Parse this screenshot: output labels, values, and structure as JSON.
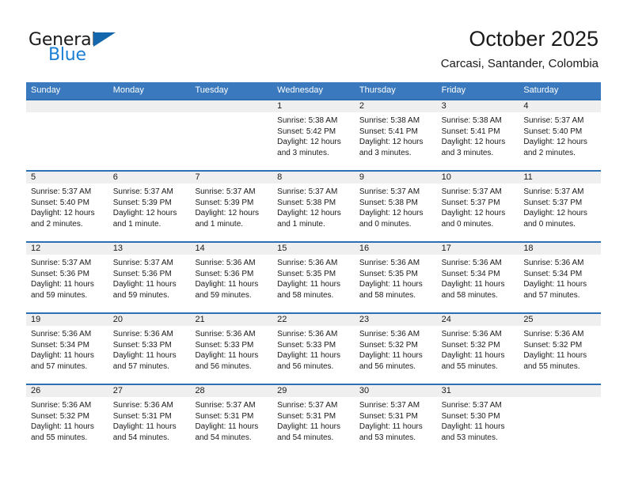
{
  "logo": {
    "text_top": "General",
    "text_bottom": "Blue",
    "accent_color": "#1c7fd4",
    "triangle_color": "#1466ad"
  },
  "header": {
    "title": "October 2025",
    "subtitle": "Carcasi, Santander, Colombia"
  },
  "theme": {
    "header_blue": "#3a79bd",
    "row_rule_blue": "#2f6fb5",
    "daynum_gray": "#efefef"
  },
  "weekdays": [
    "Sunday",
    "Monday",
    "Tuesday",
    "Wednesday",
    "Thursday",
    "Friday",
    "Saturday"
  ],
  "weeks": [
    [
      {
        "day": "",
        "sunrise": "",
        "sunset": "",
        "daylight1": "",
        "daylight2": ""
      },
      {
        "day": "",
        "sunrise": "",
        "sunset": "",
        "daylight1": "",
        "daylight2": ""
      },
      {
        "day": "",
        "sunrise": "",
        "sunset": "",
        "daylight1": "",
        "daylight2": ""
      },
      {
        "day": "1",
        "sunrise": "Sunrise: 5:38 AM",
        "sunset": "Sunset: 5:42 PM",
        "daylight1": "Daylight: 12 hours",
        "daylight2": "and 3 minutes."
      },
      {
        "day": "2",
        "sunrise": "Sunrise: 5:38 AM",
        "sunset": "Sunset: 5:41 PM",
        "daylight1": "Daylight: 12 hours",
        "daylight2": "and 3 minutes."
      },
      {
        "day": "3",
        "sunrise": "Sunrise: 5:38 AM",
        "sunset": "Sunset: 5:41 PM",
        "daylight1": "Daylight: 12 hours",
        "daylight2": "and 3 minutes."
      },
      {
        "day": "4",
        "sunrise": "Sunrise: 5:37 AM",
        "sunset": "Sunset: 5:40 PM",
        "daylight1": "Daylight: 12 hours",
        "daylight2": "and 2 minutes."
      }
    ],
    [
      {
        "day": "5",
        "sunrise": "Sunrise: 5:37 AM",
        "sunset": "Sunset: 5:40 PM",
        "daylight1": "Daylight: 12 hours",
        "daylight2": "and 2 minutes."
      },
      {
        "day": "6",
        "sunrise": "Sunrise: 5:37 AM",
        "sunset": "Sunset: 5:39 PM",
        "daylight1": "Daylight: 12 hours",
        "daylight2": "and 1 minute."
      },
      {
        "day": "7",
        "sunrise": "Sunrise: 5:37 AM",
        "sunset": "Sunset: 5:39 PM",
        "daylight1": "Daylight: 12 hours",
        "daylight2": "and 1 minute."
      },
      {
        "day": "8",
        "sunrise": "Sunrise: 5:37 AM",
        "sunset": "Sunset: 5:38 PM",
        "daylight1": "Daylight: 12 hours",
        "daylight2": "and 1 minute."
      },
      {
        "day": "9",
        "sunrise": "Sunrise: 5:37 AM",
        "sunset": "Sunset: 5:38 PM",
        "daylight1": "Daylight: 12 hours",
        "daylight2": "and 0 minutes."
      },
      {
        "day": "10",
        "sunrise": "Sunrise: 5:37 AM",
        "sunset": "Sunset: 5:37 PM",
        "daylight1": "Daylight: 12 hours",
        "daylight2": "and 0 minutes."
      },
      {
        "day": "11",
        "sunrise": "Sunrise: 5:37 AM",
        "sunset": "Sunset: 5:37 PM",
        "daylight1": "Daylight: 12 hours",
        "daylight2": "and 0 minutes."
      }
    ],
    [
      {
        "day": "12",
        "sunrise": "Sunrise: 5:37 AM",
        "sunset": "Sunset: 5:36 PM",
        "daylight1": "Daylight: 11 hours",
        "daylight2": "and 59 minutes."
      },
      {
        "day": "13",
        "sunrise": "Sunrise: 5:37 AM",
        "sunset": "Sunset: 5:36 PM",
        "daylight1": "Daylight: 11 hours",
        "daylight2": "and 59 minutes."
      },
      {
        "day": "14",
        "sunrise": "Sunrise: 5:36 AM",
        "sunset": "Sunset: 5:36 PM",
        "daylight1": "Daylight: 11 hours",
        "daylight2": "and 59 minutes."
      },
      {
        "day": "15",
        "sunrise": "Sunrise: 5:36 AM",
        "sunset": "Sunset: 5:35 PM",
        "daylight1": "Daylight: 11 hours",
        "daylight2": "and 58 minutes."
      },
      {
        "day": "16",
        "sunrise": "Sunrise: 5:36 AM",
        "sunset": "Sunset: 5:35 PM",
        "daylight1": "Daylight: 11 hours",
        "daylight2": "and 58 minutes."
      },
      {
        "day": "17",
        "sunrise": "Sunrise: 5:36 AM",
        "sunset": "Sunset: 5:34 PM",
        "daylight1": "Daylight: 11 hours",
        "daylight2": "and 58 minutes."
      },
      {
        "day": "18",
        "sunrise": "Sunrise: 5:36 AM",
        "sunset": "Sunset: 5:34 PM",
        "daylight1": "Daylight: 11 hours",
        "daylight2": "and 57 minutes."
      }
    ],
    [
      {
        "day": "19",
        "sunrise": "Sunrise: 5:36 AM",
        "sunset": "Sunset: 5:34 PM",
        "daylight1": "Daylight: 11 hours",
        "daylight2": "and 57 minutes."
      },
      {
        "day": "20",
        "sunrise": "Sunrise: 5:36 AM",
        "sunset": "Sunset: 5:33 PM",
        "daylight1": "Daylight: 11 hours",
        "daylight2": "and 57 minutes."
      },
      {
        "day": "21",
        "sunrise": "Sunrise: 5:36 AM",
        "sunset": "Sunset: 5:33 PM",
        "daylight1": "Daylight: 11 hours",
        "daylight2": "and 56 minutes."
      },
      {
        "day": "22",
        "sunrise": "Sunrise: 5:36 AM",
        "sunset": "Sunset: 5:33 PM",
        "daylight1": "Daylight: 11 hours",
        "daylight2": "and 56 minutes."
      },
      {
        "day": "23",
        "sunrise": "Sunrise: 5:36 AM",
        "sunset": "Sunset: 5:32 PM",
        "daylight1": "Daylight: 11 hours",
        "daylight2": "and 56 minutes."
      },
      {
        "day": "24",
        "sunrise": "Sunrise: 5:36 AM",
        "sunset": "Sunset: 5:32 PM",
        "daylight1": "Daylight: 11 hours",
        "daylight2": "and 55 minutes."
      },
      {
        "day": "25",
        "sunrise": "Sunrise: 5:36 AM",
        "sunset": "Sunset: 5:32 PM",
        "daylight1": "Daylight: 11 hours",
        "daylight2": "and 55 minutes."
      }
    ],
    [
      {
        "day": "26",
        "sunrise": "Sunrise: 5:36 AM",
        "sunset": "Sunset: 5:32 PM",
        "daylight1": "Daylight: 11 hours",
        "daylight2": "and 55 minutes."
      },
      {
        "day": "27",
        "sunrise": "Sunrise: 5:36 AM",
        "sunset": "Sunset: 5:31 PM",
        "daylight1": "Daylight: 11 hours",
        "daylight2": "and 54 minutes."
      },
      {
        "day": "28",
        "sunrise": "Sunrise: 5:37 AM",
        "sunset": "Sunset: 5:31 PM",
        "daylight1": "Daylight: 11 hours",
        "daylight2": "and 54 minutes."
      },
      {
        "day": "29",
        "sunrise": "Sunrise: 5:37 AM",
        "sunset": "Sunset: 5:31 PM",
        "daylight1": "Daylight: 11 hours",
        "daylight2": "and 54 minutes."
      },
      {
        "day": "30",
        "sunrise": "Sunrise: 5:37 AM",
        "sunset": "Sunset: 5:31 PM",
        "daylight1": "Daylight: 11 hours",
        "daylight2": "and 53 minutes."
      },
      {
        "day": "31",
        "sunrise": "Sunrise: 5:37 AM",
        "sunset": "Sunset: 5:30 PM",
        "daylight1": "Daylight: 11 hours",
        "daylight2": "and 53 minutes."
      },
      {
        "day": "",
        "sunrise": "",
        "sunset": "",
        "daylight1": "",
        "daylight2": ""
      }
    ]
  ]
}
